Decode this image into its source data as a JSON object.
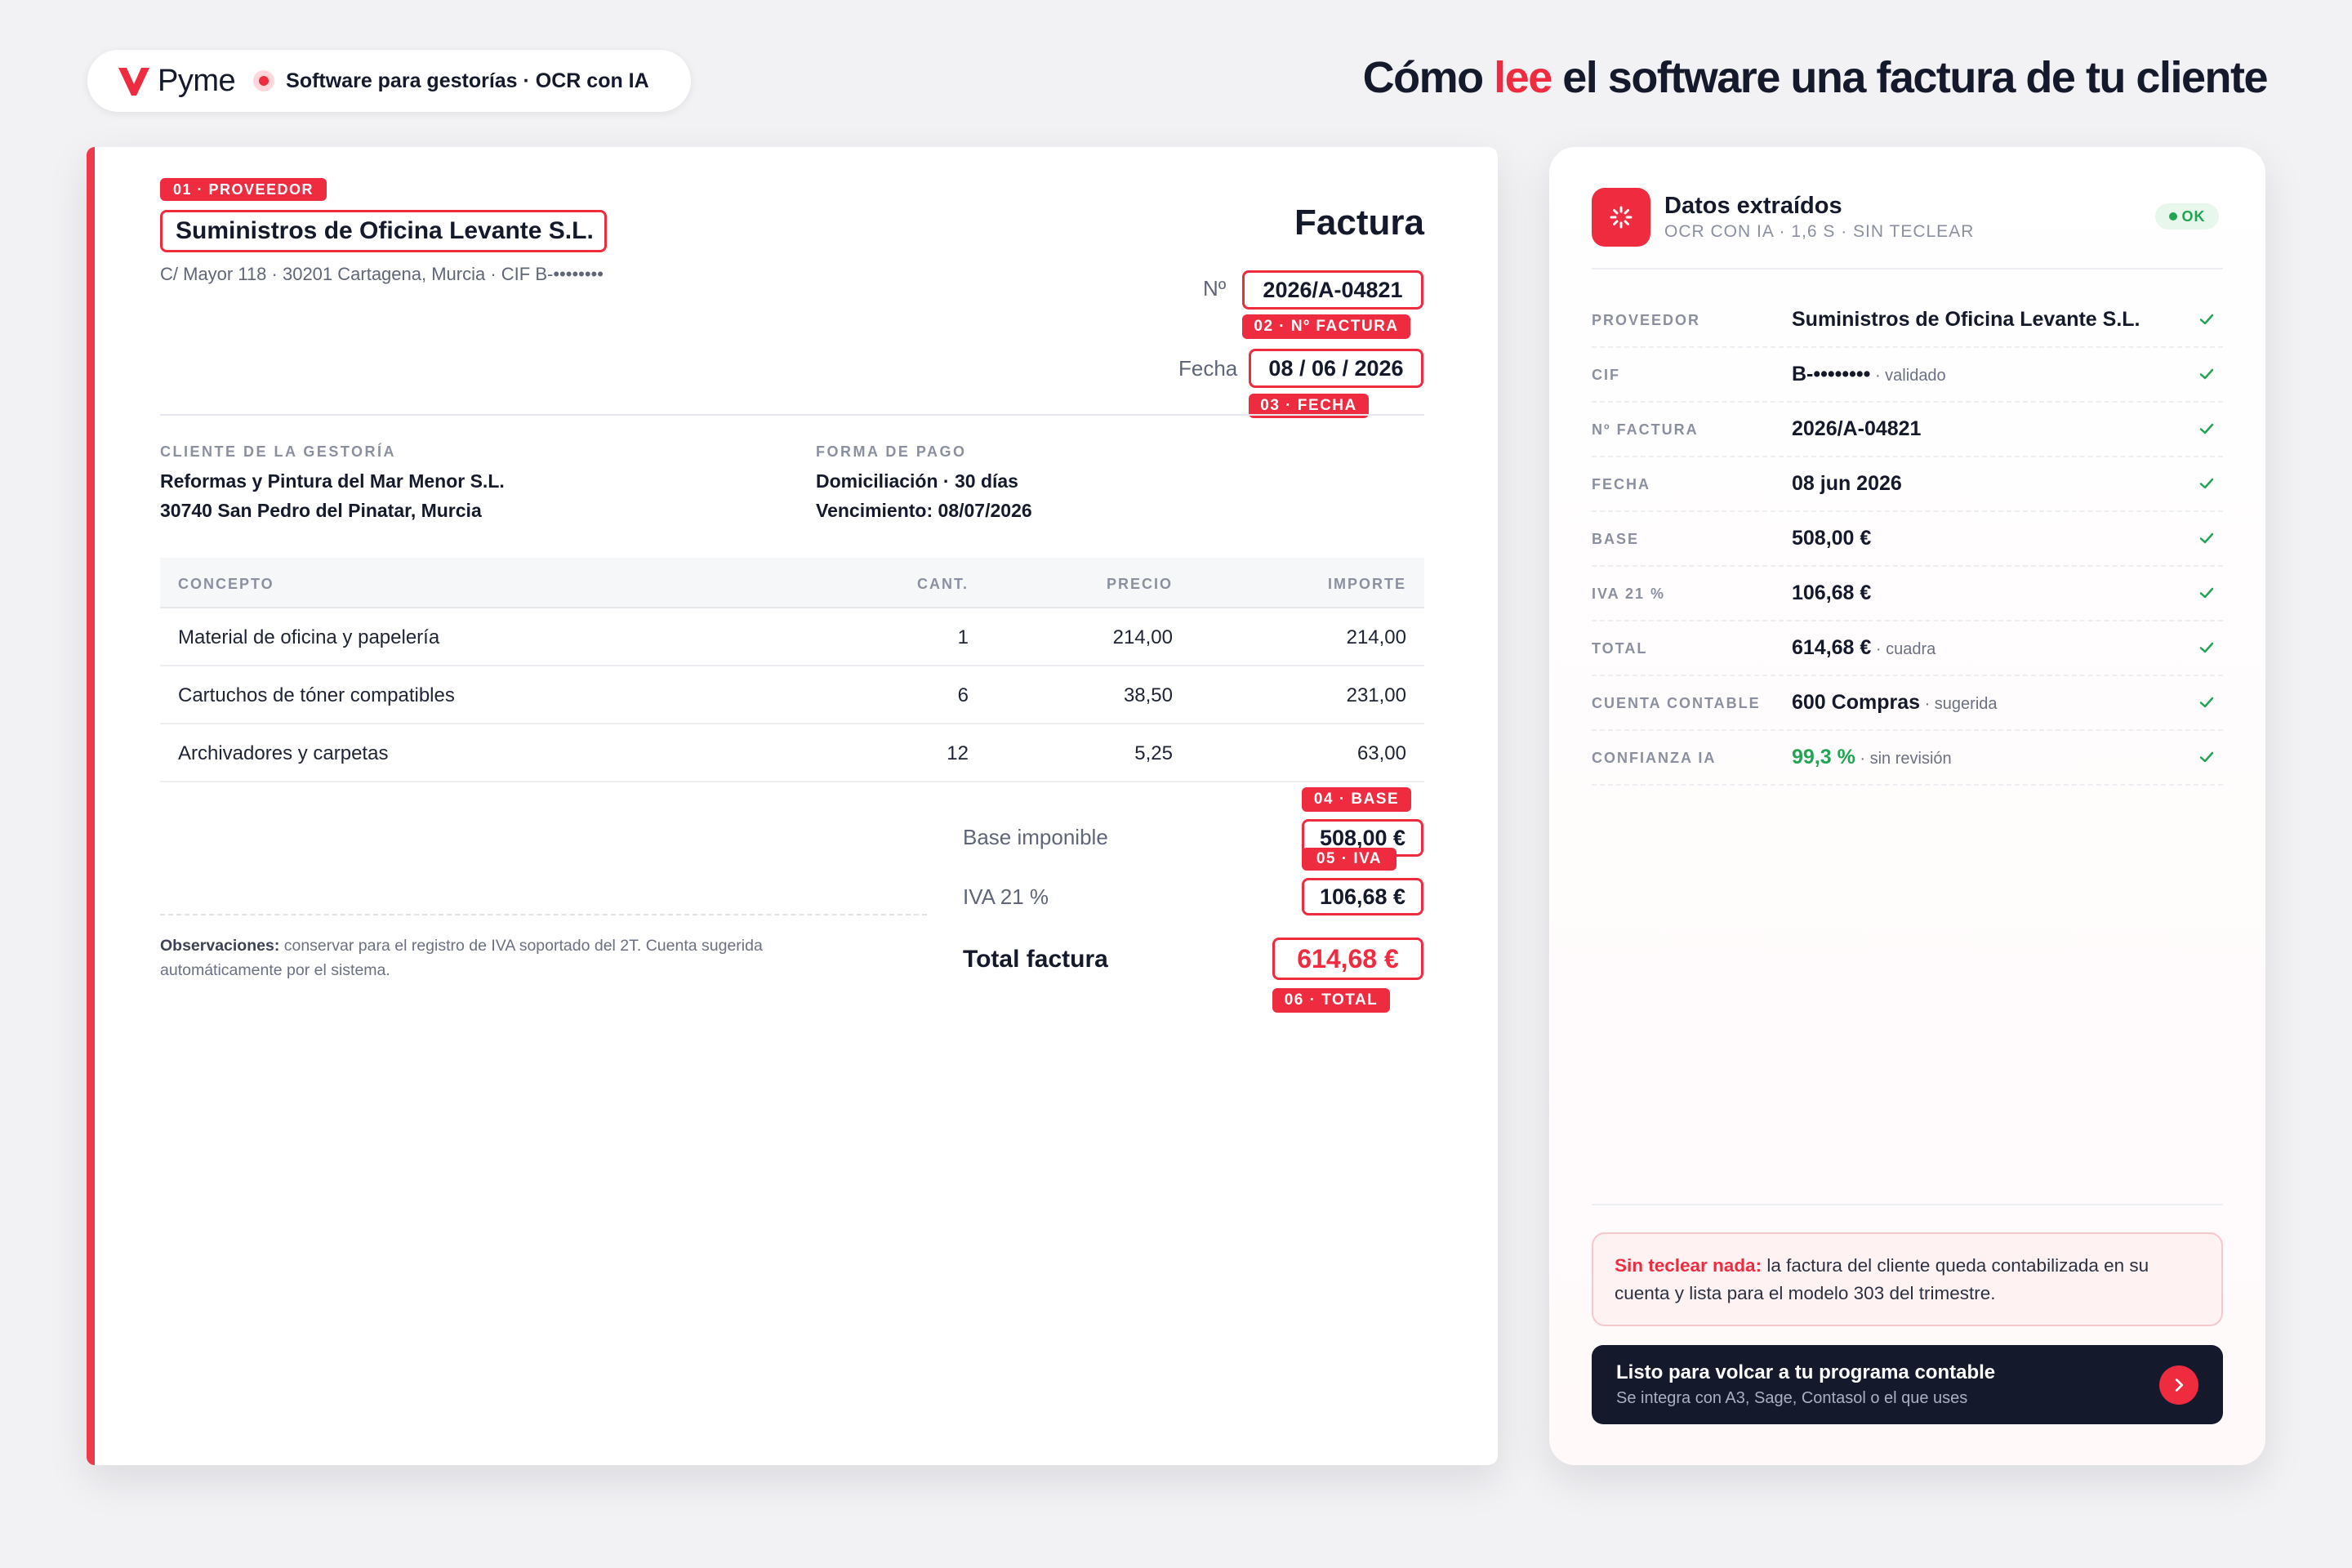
{
  "brand": {
    "name": "Pyme",
    "tagline": "Software para gestorías · OCR con IA"
  },
  "headline": {
    "before": "Cómo ",
    "highlight": "lee",
    "after": " el software una factura de tu cliente"
  },
  "invoice": {
    "supplier_tag": "01 · PROVEEDOR",
    "supplier_name": "Suministros de Oficina Levante S.L.",
    "supplier_address": "C/ Mayor 118 · 30201 Cartagena, Murcia · CIF B-••••••••",
    "doc_title": "Factura",
    "number_label": "Nº",
    "number_value": "2026/A-04821",
    "number_tag": "02 · Nº FACTURA",
    "date_label": "Fecha",
    "date_value": "08 / 06 / 2026",
    "date_tag": "03 · FECHA",
    "client_label": "CLIENTE DE LA GESTORÍA",
    "client_name": "Reformas y Pintura del Mar Menor S.L.",
    "client_address": "30740 San Pedro del Pinatar, Murcia",
    "payment_label": "FORMA DE PAGO",
    "payment_method": "Domiciliación · 30 días",
    "payment_due": "Vencimiento: 08/07/2026",
    "table": {
      "headers": [
        "CONCEPTO",
        "CANT.",
        "PRECIO",
        "IMPORTE"
      ],
      "rows": [
        [
          "Material de oficina y papelería",
          "1",
          "214,00",
          "214,00"
        ],
        [
          "Cartuchos de tóner compatibles",
          "6",
          "38,50",
          "231,00"
        ],
        [
          "Archivadores y carpetas",
          "12",
          "5,25",
          "63,00"
        ]
      ]
    },
    "base_tag": "04 · BASE",
    "base_label": "Base imponible",
    "base_value": "508,00 €",
    "iva_tag": "05 · IVA",
    "iva_label": "IVA 21 %",
    "iva_value": "106,68 €",
    "total_label": "Total factura",
    "total_value": "614,68 €",
    "total_tag": "06 · TOTAL",
    "observations_label": "Observaciones:",
    "observations_text": " conservar para el registro de IVA soportado del 2T. Cuenta sugerida automáticamente por el sistema."
  },
  "panel": {
    "title": "Datos extraídos",
    "subtitle": "OCR CON IA · 1,6 S · SIN TECLEAR",
    "badge": "OK",
    "fields": [
      {
        "label": "PROVEEDOR",
        "value": "Suministros de Oficina Levante S.L.",
        "note": ""
      },
      {
        "label": "CIF",
        "value": "B-••••••••",
        "note": " · validado"
      },
      {
        "label": "Nº FACTURA",
        "value": "2026/A-04821",
        "note": ""
      },
      {
        "label": "FECHA",
        "value": "08 jun 2026",
        "note": ""
      },
      {
        "label": "BASE",
        "value": "508,00 €",
        "note": ""
      },
      {
        "label": "IVA 21 %",
        "value": "106,68 €",
        "note": ""
      },
      {
        "label": "TOTAL",
        "value": "614,68 €",
        "note": " · cuadra"
      },
      {
        "label": "CUENTA CONTABLE",
        "value": "600 Compras",
        "note": " · sugerida"
      },
      {
        "label": "CONFIANZA IA",
        "value": "99,3 %",
        "note": " · sin revisión"
      }
    ],
    "note_bold": "Sin teclear nada:",
    "note_text": " la factura del cliente queda contabilizada en su cuenta y lista para el modelo 303 del trimestre.",
    "cta_title": "Listo para volcar a tu programa contable",
    "cta_subtitle": "Se integra con A3, Sage, Contasol o el que uses"
  },
  "colors": {
    "accent": "#ef2b40",
    "dark": "#141a2b",
    "success": "#23a455",
    "muted": "#8a90a0"
  },
  "icons": [
    "pyme-logo-icon",
    "record-dot-icon",
    "scan-icon",
    "status-dot-icon",
    "check-icon",
    "chevron-right-icon"
  ]
}
